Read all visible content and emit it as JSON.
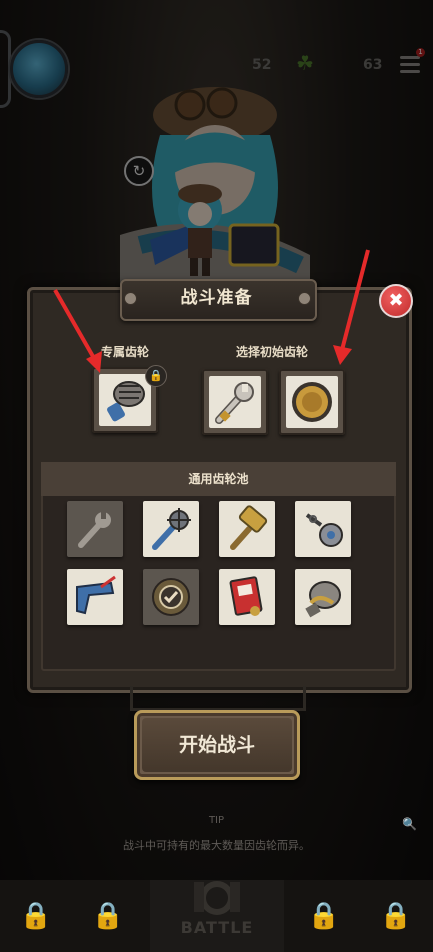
{
  "top_bar": {
    "resource_1": "52",
    "resource_3": "63",
    "notification_count": "1"
  },
  "panel": {
    "title": "战斗准备",
    "close_icon": "close-x-icon",
    "exclusive_label": "专属齿轮",
    "initial_label": "选择初始齿轮",
    "exclusive_gear": {
      "icon": "gauntlet-icon",
      "locked": true
    },
    "initial_gears": [
      {
        "icon": "wrench-icon"
      },
      {
        "icon": "round-shield-icon"
      }
    ],
    "pool_title": "通用齿轮池",
    "pool": [
      {
        "icon": "wrench-icon",
        "state": "selected-dim"
      },
      {
        "icon": "spiked-mace-icon",
        "state": "normal"
      },
      {
        "icon": "golden-hammer-icon",
        "state": "normal"
      },
      {
        "icon": "chain-flail-icon",
        "state": "normal"
      },
      {
        "icon": "blue-gun-icon",
        "state": "normal"
      },
      {
        "icon": "round-shield-icon",
        "state": "selected-check"
      },
      {
        "icon": "red-card-icon",
        "state": "normal"
      },
      {
        "icon": "gauntlet-icon",
        "state": "normal"
      }
    ]
  },
  "start_button": "开始战斗",
  "tip": {
    "label": "TIP",
    "text": "战斗中可持有的最大数量因齿轮而异。"
  },
  "bottom_nav": {
    "battle_label": "BATTLE"
  },
  "colors": {
    "annotation_arrow": "#e52a2a",
    "close_button": "#d63838",
    "panel_bg": "#2f2923"
  }
}
